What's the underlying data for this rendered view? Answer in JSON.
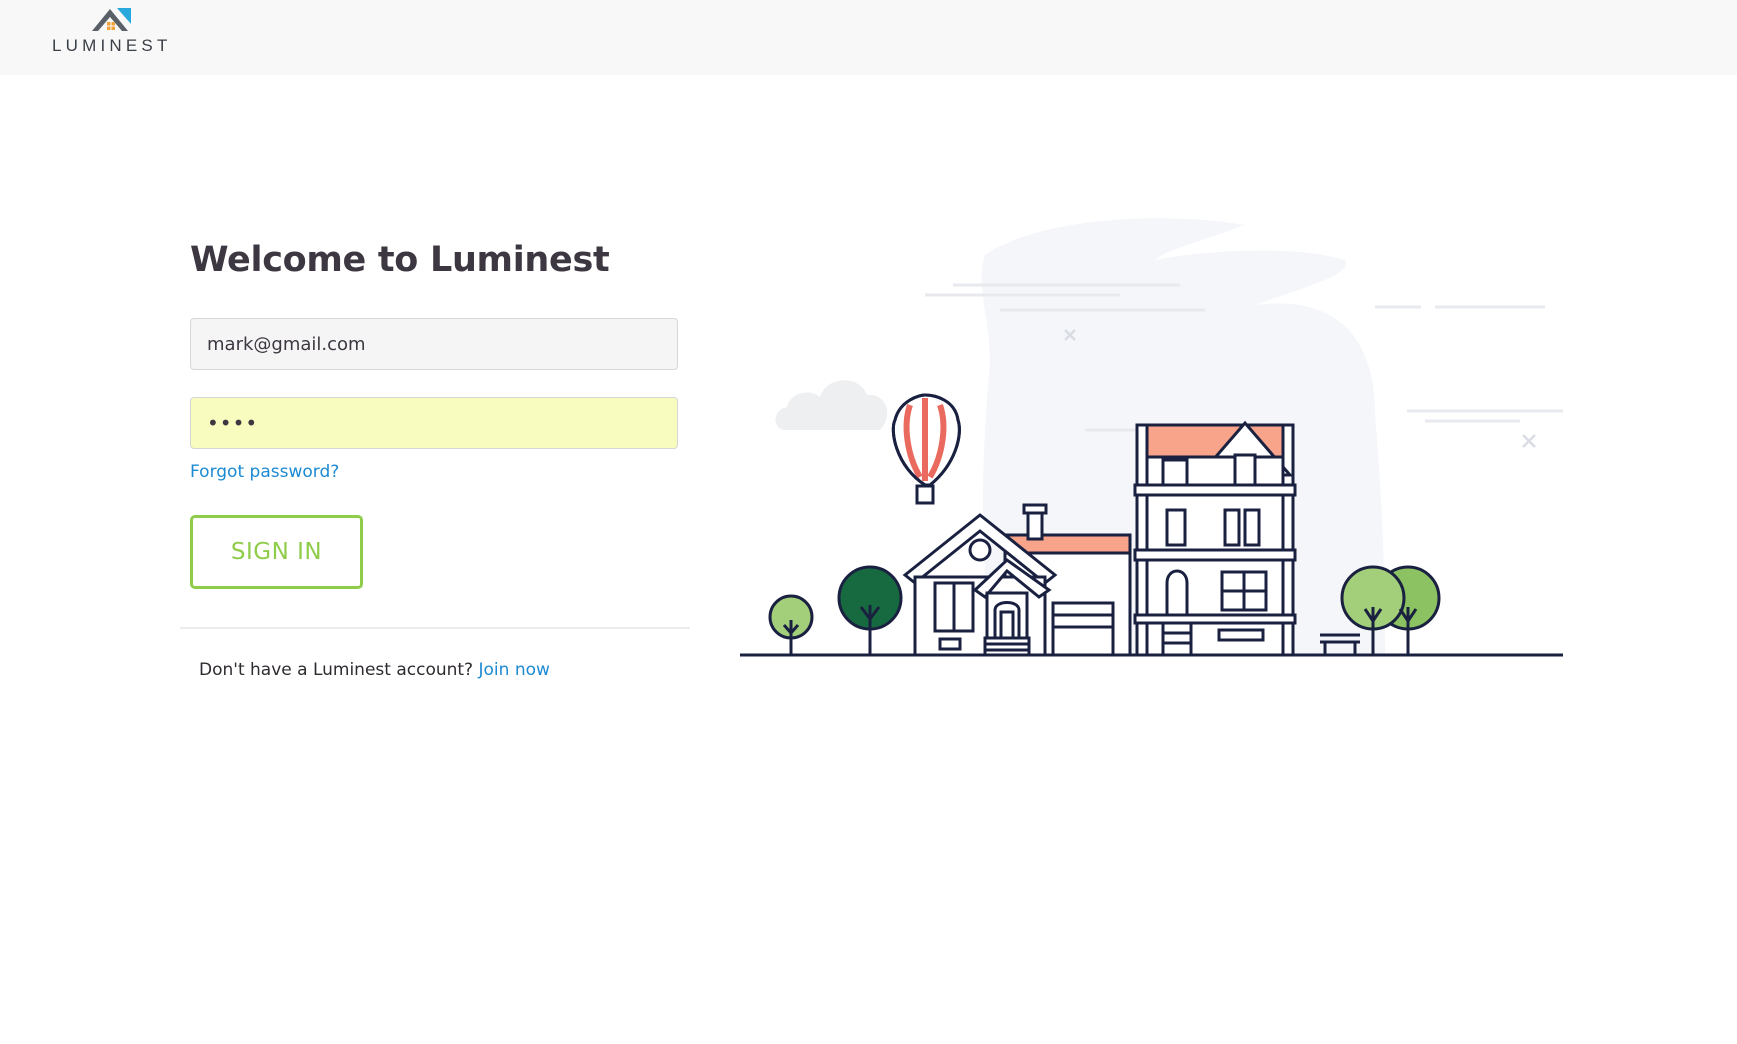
{
  "header": {
    "logo_text": "LUMINEST"
  },
  "login": {
    "title": "Welcome to Luminest",
    "email_value": "mark@gmail.com",
    "password_value": "••••",
    "forgot_label": "Forgot password?",
    "signin_label": "SIGN IN",
    "no_account_text": "Don't have a Luminest account?",
    "join_label": "Join now"
  },
  "colors": {
    "accent_green": "#8fcc4a",
    "link_blue": "#1c8ad3",
    "password_autofill": "#f8fcbe",
    "navy_outline": "#1a2140",
    "roof_salmon": "#f7a48a",
    "balloon_red": "#ea6a5f"
  },
  "icons": {
    "logo": "house-roof-icon",
    "illustration": "neighborhood-houses-illustration"
  }
}
